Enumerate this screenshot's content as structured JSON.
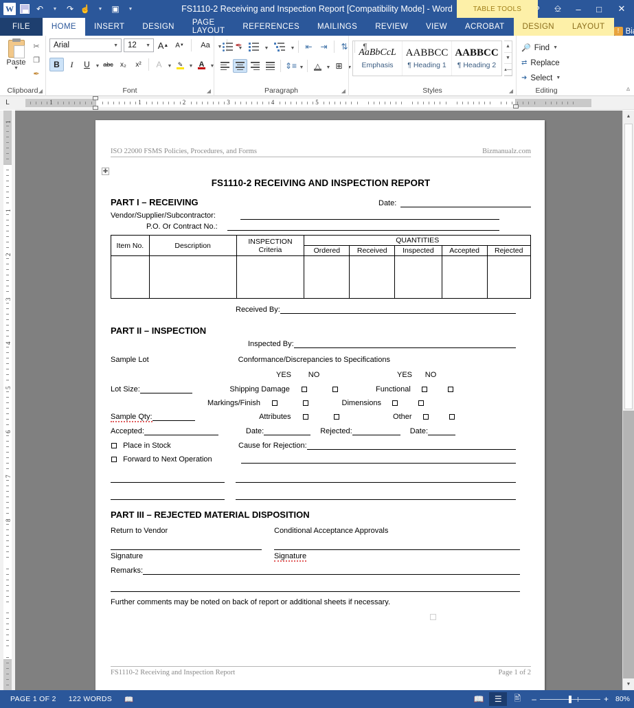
{
  "titlebar": {
    "app_icon": "word-logo",
    "quick_access": [
      {
        "name": "save-icon",
        "glyph": "▤"
      },
      {
        "name": "undo-icon",
        "glyph": "↶"
      },
      {
        "name": "redo-icon",
        "glyph": "↷"
      },
      {
        "name": "touch-mode-icon",
        "glyph": "☝"
      },
      {
        "name": "customize-qat-icon",
        "glyph": "▣"
      }
    ],
    "title": "FS1110-2 Receiving and Inspection Report [Compatibility Mode] - Word",
    "contextual_tools_label": "TABLE TOOLS",
    "help_label": "?",
    "ribbon_display_label": "⬜",
    "minimize_label": "–",
    "restore_label": "❑",
    "close_label": "✕"
  },
  "ribbon": {
    "tabs": [
      {
        "label": "FILE",
        "kind": "file"
      },
      {
        "label": "HOME",
        "kind": "active"
      },
      {
        "label": "INSERT",
        "kind": "normal"
      },
      {
        "label": "DESIGN",
        "kind": "normal"
      },
      {
        "label": "PAGE LAYOUT",
        "kind": "normal"
      },
      {
        "label": "REFERENCES",
        "kind": "normal"
      },
      {
        "label": "MAILINGS",
        "kind": "normal"
      },
      {
        "label": "REVIEW",
        "kind": "normal"
      },
      {
        "label": "VIEW",
        "kind": "normal"
      },
      {
        "label": "ACROBAT",
        "kind": "normal"
      },
      {
        "label": "DESIGN",
        "kind": "tool"
      },
      {
        "label": "LAYOUT",
        "kind": "tool"
      }
    ],
    "account_name": "Bianca...",
    "groups": {
      "clipboard": {
        "label": "Clipboard",
        "paste_label": "Paste",
        "cut_label": "✂",
        "copy_label": "⧉",
        "format_painter_label": "✎"
      },
      "font": {
        "label": "Font",
        "font_name": "Arial",
        "font_size": "12",
        "grow_label": "A",
        "shrink_label": "A",
        "change_case_label": "Aa",
        "clear_format_label": "✐",
        "bold_label": "B",
        "italic_label": "I",
        "underline_label": "U",
        "strikethrough_label": "abc",
        "subscript_label": "x₂",
        "superscript_label": "x²",
        "text_effects_label": "A",
        "highlight_label": "ab",
        "font_color_label": "A"
      },
      "paragraph": {
        "label": "Paragraph",
        "sort_label": "↕",
        "show_marks_label": "¶",
        "line_spacing_label": "↕",
        "shading_label": "△",
        "borders_label": "⊞"
      },
      "styles": {
        "label": "Styles",
        "items": [
          {
            "preview": "AaBbCcL",
            "name": "Emphasis",
            "style": "em"
          },
          {
            "preview": "AABBCC",
            "name": "¶ Heading 1",
            "style": "h1"
          },
          {
            "preview": "AABBCC",
            "name": "¶ Heading 2",
            "style": "h2"
          }
        ]
      },
      "editing": {
        "label": "Editing",
        "find_label": "Find",
        "replace_label": "Replace",
        "select_label": "Select"
      }
    },
    "collapse_label": "⌃"
  },
  "ruler": {
    "corner_tab": "L",
    "h_numbers": [
      "1",
      "1",
      "2",
      "3",
      "4",
      "5"
    ],
    "v_numbers": [
      "1",
      "1",
      "2",
      "3",
      "4",
      "5",
      "6",
      "7",
      "8"
    ]
  },
  "document": {
    "header_left": "ISO 22000 FSMS Policies, Procedures, and Forms",
    "header_right": "Bizmanualz.com",
    "table_move_handle": "✥",
    "title": "FS1110-2 RECEIVING AND INSPECTION REPORT",
    "part1": {
      "heading": "PART I – RECEIVING",
      "date_label": "Date:",
      "vendor_label": "Vendor/Supplier/Subcontractor:",
      "po_label": "P.O.  Or Contract No.:",
      "table": {
        "col_item": "Item No.",
        "col_description": "Description",
        "col_inspection": "INSPECTION",
        "col_criteria": "Criteria",
        "quantities_label": "QUANTITIES",
        "quantity_cols": [
          "Ordered",
          "Received",
          "Inspected",
          "Accepted",
          "Rejected"
        ]
      },
      "received_by_label": "Received By:"
    },
    "part2": {
      "heading": "PART II – INSPECTION",
      "inspected_by_label": "Inspected By:",
      "sample_lot_label": "Sample Lot",
      "conformance_label": "Conformance/Discrepancies to Specifications",
      "yes_label": "YES",
      "no_label": "NO",
      "lot_size_label": "Lot Size:",
      "sample_qty_label": "Sample Qty:",
      "left_checks": [
        "Shipping Damage",
        "Markings/Finish",
        "Attributes"
      ],
      "right_checks": [
        "Functional",
        "Dimensions",
        "Other"
      ],
      "accepted_label": "Accepted:",
      "date_label": "Date:",
      "rejected_label": "Rejected:",
      "date2_label": "Date:",
      "place_in_stock_label": "Place in Stock",
      "forward_label": "Forward to Next Operation",
      "cause_label": "Cause for Rejection:"
    },
    "part3": {
      "heading": "PART III – REJECTED MATERIAL DISPOSITION",
      "return_label": "Return to Vendor",
      "conditional_label": "Conditional Acceptance Approvals",
      "signature_left_label": "Signature",
      "signature_right_label": "Signature",
      "remarks_label": "Remarks:",
      "note": "Further comments may be noted on back of report or additional sheets if necessary."
    },
    "footer_left": "FS1110-2 Receiving and Inspection Report",
    "footer_right": "Page 1 of 2"
  },
  "statusbar": {
    "page_label": "PAGE 1 OF 2",
    "words_label": "122 WORDS",
    "proofing_label": "▧",
    "views": [
      {
        "name": "read-mode-icon",
        "glyph": "◫",
        "active": false
      },
      {
        "name": "print-layout-icon",
        "glyph": "▤",
        "active": true
      },
      {
        "name": "web-layout-icon",
        "glyph": "▥",
        "active": false
      }
    ],
    "zoom_out_label": "–",
    "zoom_in_label": "+",
    "zoom_percent": "80%"
  },
  "colors": {
    "word_blue": "#2b579a",
    "tool_tab_yellow": "#fdf0a8",
    "canvas_gray": "#808080",
    "spell_red": "#e05a5a"
  }
}
